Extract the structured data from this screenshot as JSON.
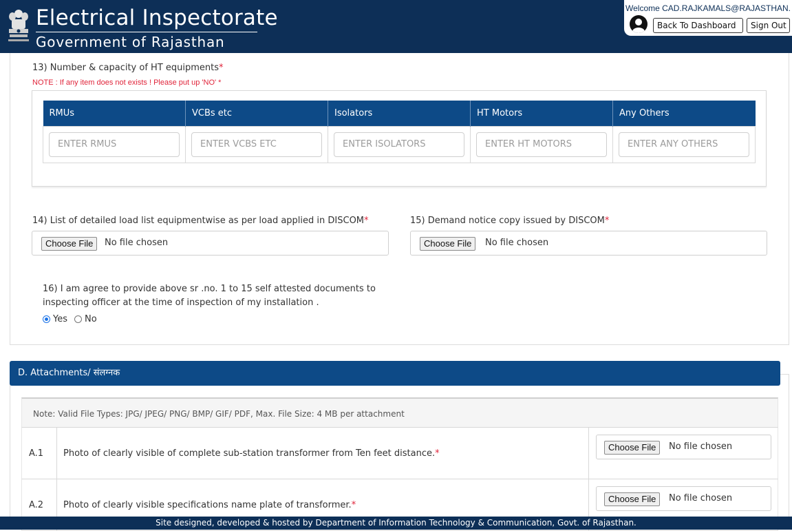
{
  "header": {
    "title": "Electrical Inspectorate",
    "subtitle": "Government of Rajasthan",
    "welcome": "Welcome CAD.RAJKAMALS@RAJASTHAN....",
    "back_button": "Back To Dashboard",
    "signout_button": "Sign Out",
    "avatar_icon": "user-avatar-icon",
    "emblem_icon": "state-emblem-icon"
  },
  "q13": {
    "label": "13) Number & capacity of HT equipments",
    "required_mark": "*",
    "note": "NOTE : If any item does not exists ! Please put up 'NO' *",
    "columns": [
      "RMUs",
      "VCBs etc",
      "Isolators",
      "HT Motors",
      "Any Others"
    ],
    "placeholders": [
      "ENTER RMUS",
      "ENTER VCBS ETC",
      "ENTER ISOLATORS",
      "ENTER HT MOTORS",
      "ENTER ANY OTHERS"
    ]
  },
  "q14": {
    "label": "14) List of detailed load list equipmentwise as per load applied in DISCOM",
    "required_mark": "*",
    "button": "Choose File",
    "status": "No file chosen"
  },
  "q15": {
    "label": "15) Demand notice copy issued by DISCOM",
    "required_mark": "*",
    "button": "Choose File",
    "status": "No file chosen"
  },
  "q16": {
    "line1": "16) I am agree to provide above sr .no. 1 to 15 self attested documents to",
    "line2": "inspecting officer at the time of inspection of my installation .",
    "options": [
      "Yes",
      "No"
    ],
    "selected": "Yes"
  },
  "attachments": {
    "heading": "D. Attachments/ संलग्नक",
    "note": "Note: Valid File Types: JPG/ JPEG/ PNG/ BMP/ GIF/ PDF, Max. File Size: 4 MB per attachment",
    "rows": [
      {
        "no": "A.1",
        "desc": "Photo of clearly visible of complete sub-station transformer from Ten feet distance.",
        "required_mark": "*",
        "button": "Choose File",
        "status": "No file chosen"
      },
      {
        "no": "A.2",
        "desc": "Photo of clearly visible specifications name plate of transformer.",
        "required_mark": "*",
        "button": "Choose File",
        "status": "No file chosen"
      }
    ]
  },
  "footer": {
    "text": "Site designed, developed & hosted by Department of Information Technology & Communication, Govt. of Rajasthan."
  },
  "colors": {
    "header_bg": "#0d2f57",
    "table_header_bg": "#0d4a87",
    "required": "#e0243a"
  }
}
